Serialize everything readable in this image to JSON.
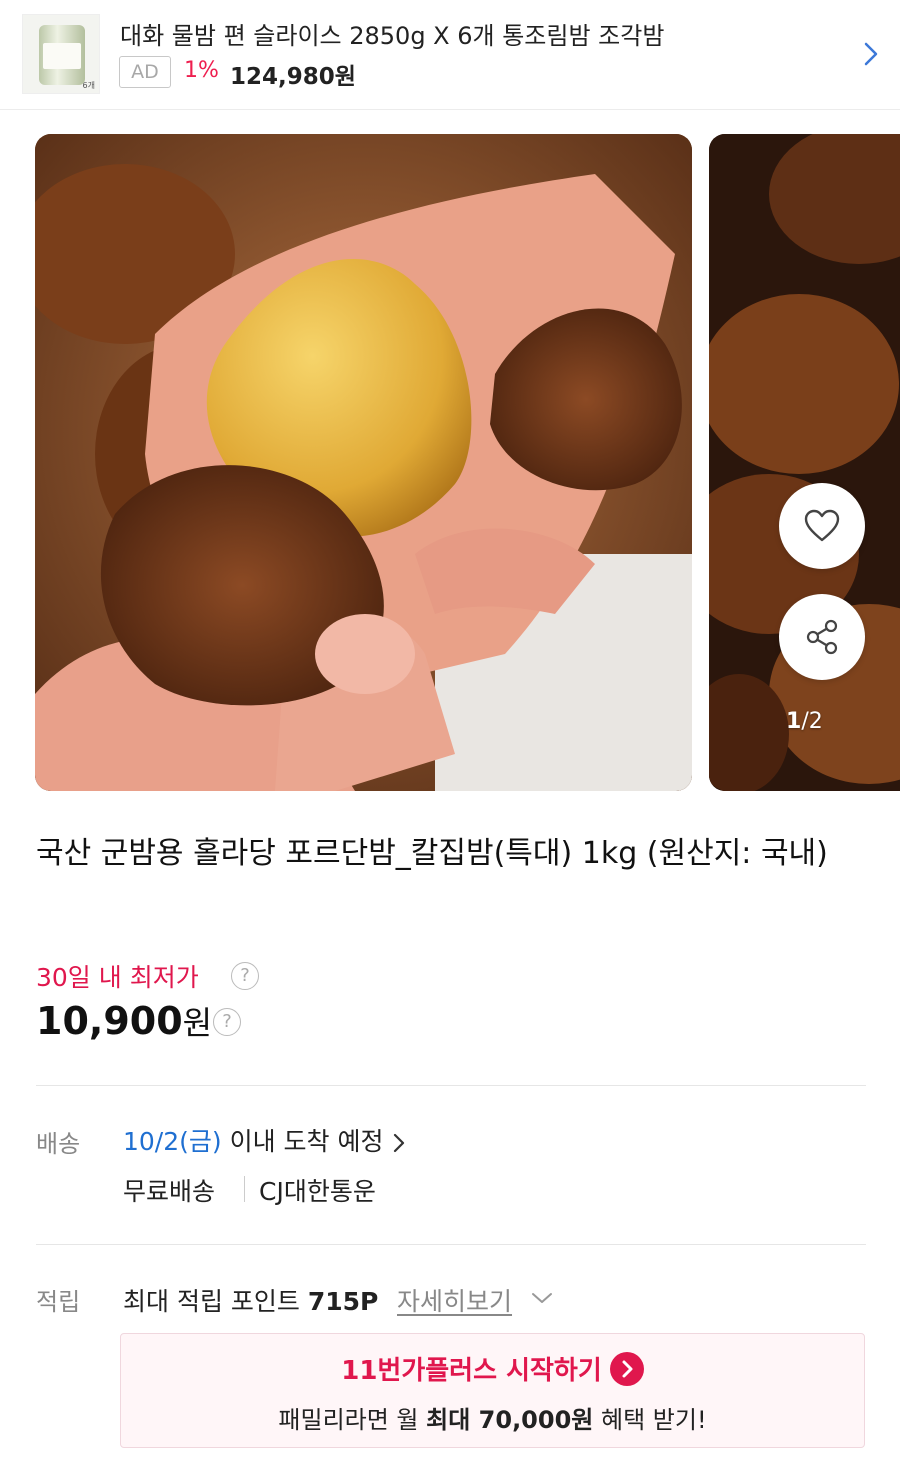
{
  "ad": {
    "thumb_count": "6개",
    "title": "대화 물밤 편 슬라이스 2850g X 6개 통조림밤 조각밤",
    "tag": "AD",
    "discount": "1%",
    "price": "124,980원"
  },
  "carousel": {
    "current": "1",
    "total": "/2"
  },
  "product": {
    "title": "국산 군밤용 홀라당 포르단밤_칼집밤(특대) 1kg (원산지: 국내)",
    "lowest_label": "30일 내 최저가",
    "help": "?",
    "price_number": "10,900",
    "price_unit": "원"
  },
  "shipping": {
    "label": "배송",
    "date": "10/2(금)",
    "date_suffix": " 이내 도착 예정",
    "free": "무료배송",
    "carrier": "CJ대한통운"
  },
  "points": {
    "label": "적립",
    "text_prefix": "최대 적립 포인트 ",
    "value": "715P",
    "more": "자세히보기"
  },
  "promo": {
    "title": "11번가플러스 시작하기",
    "sub_prefix": "패밀리라면 월 ",
    "sub_bold": "최대 70,000원",
    "sub_suffix": " 혜택 받기!"
  }
}
